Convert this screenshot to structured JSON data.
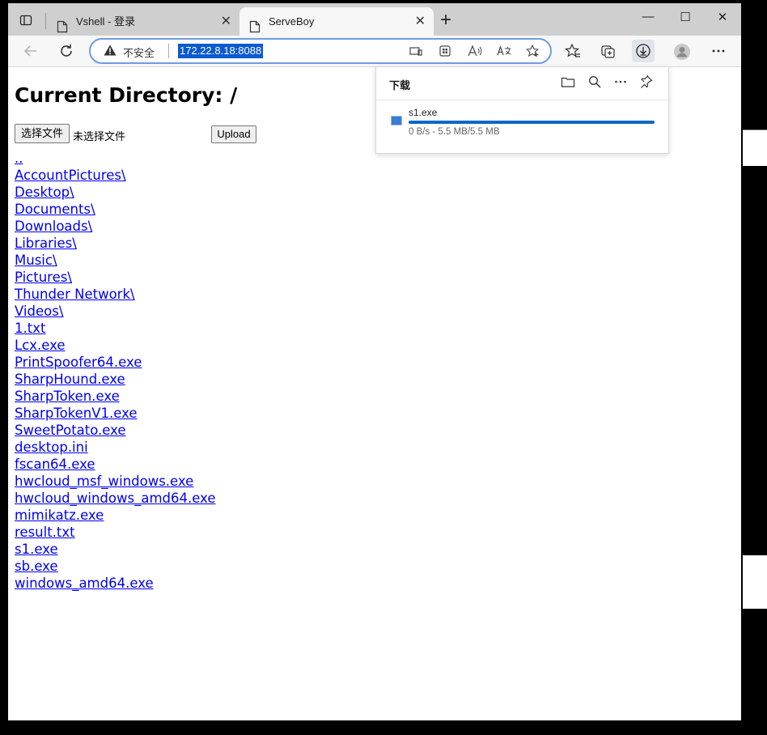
{
  "browser": {
    "tabs": [
      {
        "label": "Vshell - 登录",
        "active": false
      },
      {
        "label": "ServeBoy",
        "active": true
      }
    ],
    "close_glyph": "✕",
    "new_tab_glyph": "+",
    "address": {
      "security_label": "不安全",
      "url": "172.22.8.18:8088"
    },
    "window_controls": {
      "minimize": "—",
      "maximize": "☐",
      "close": "✕"
    }
  },
  "page": {
    "heading": "Current Directory: /",
    "upload": {
      "choose_label": "选择文件",
      "no_file_label": "未选择文件",
      "upload_label": "Upload"
    },
    "entries": [
      "..",
      "AccountPictures\\",
      "Desktop\\",
      "Documents\\",
      "Downloads\\",
      "Libraries\\",
      "Music\\",
      "Pictures\\",
      "Thunder Network\\",
      "Videos\\",
      "1.txt",
      "Lcx.exe",
      "PrintSpoofer64.exe",
      "SharpHound.exe",
      "SharpToken.exe",
      "SharpTokenV1.exe",
      "SweetPotato.exe",
      "desktop.ini",
      "fscan64.exe",
      "hwcloud_msf_windows.exe",
      "hwcloud_windows_amd64.exe",
      "mimikatz.exe",
      "result.txt",
      "s1.exe",
      "sb.exe",
      "windows_amd64.exe"
    ]
  },
  "downloads_panel": {
    "title": "下载",
    "item": {
      "name": "s1.exe",
      "status": "0 B/s - 5.5 MB/5.5 MB",
      "progress_percent": 100
    }
  },
  "colors": {
    "accent": "#0a67c8",
    "link": "#0000ee",
    "url_highlight": "#0a5ad0"
  }
}
